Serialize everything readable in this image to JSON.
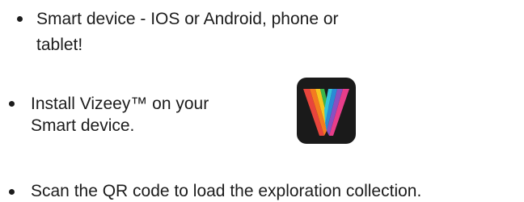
{
  "requirements": {
    "items": [
      {
        "lines": [
          "Smart device - IOS or Android, phone or",
          "tablet!"
        ]
      },
      {
        "lines": [
          "Install Vizeey™ on your",
          "Smart device."
        ],
        "app_icon": "vizeey-app-icon"
      },
      {
        "lines": [
          "Scan the QR code to load the exploration collection."
        ]
      }
    ]
  },
  "colors": {
    "text": "#1c1c1c",
    "icon_background": "#1a1a1a"
  }
}
